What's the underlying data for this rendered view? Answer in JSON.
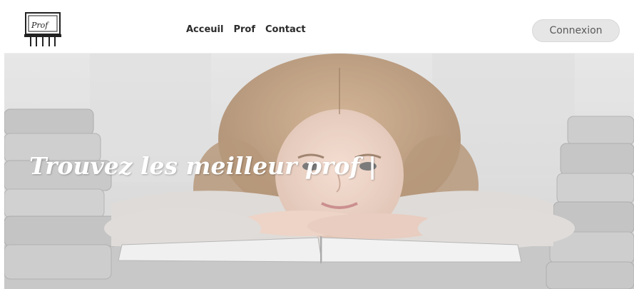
{
  "header": {
    "logo_text": "Prof",
    "nav": [
      {
        "label": "Acceuil"
      },
      {
        "label": "Prof"
      },
      {
        "label": "Contact"
      }
    ],
    "login_label": "Connexion"
  },
  "hero": {
    "title": "Trouvez les meilleur prof |"
  },
  "colors": {
    "header_bg": "#ffffff",
    "login_bg": "#e6e6e6",
    "hero_text": "#ffffff"
  },
  "icons": {
    "logo": "board-icon"
  }
}
